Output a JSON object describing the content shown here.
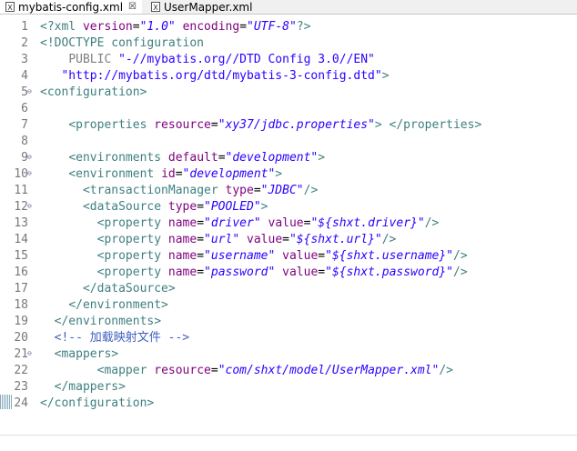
{
  "tabs": [
    {
      "label": "mybatis-config.xml",
      "close": "☒"
    },
    {
      "label": "UserMapper.xml"
    }
  ],
  "editor": {
    "lines": [
      {
        "n": "1",
        "fold": "",
        "html": "<span class=\"pi\">&lt;?xml</span> <span class=\"attr\">version</span><span class=\"text\">=</span><span class=\"val\">\"1.0\"</span> <span class=\"attr\">encoding</span><span class=\"text\">=</span><span class=\"val\">\"UTF-8\"</span><span class=\"pi\">?&gt;</span>"
      },
      {
        "n": "2",
        "fold": "",
        "html": "<span class=\"doctype\">&lt;!DOCTYPE configuration</span>"
      },
      {
        "n": "3",
        "fold": "",
        "html": "    <span class=\"pub\">PUBLIC</span> <span class=\"val\" style=\"font-style:normal\">\"-//mybatis.org//DTD Config 3.0//EN\"</span>"
      },
      {
        "n": "4",
        "fold": "",
        "html": "   <span class=\"val\" style=\"font-style:normal\">\"http://mybatis.org/dtd/mybatis-3-config.dtd\"</span><span class=\"doctype\">&gt;</span>"
      },
      {
        "n": "5",
        "fold": "⊖",
        "html": "<span class=\"tag\">&lt;configuration&gt;</span>"
      },
      {
        "n": "6",
        "fold": "",
        "html": ""
      },
      {
        "n": "7",
        "fold": "",
        "html": "    <span class=\"tag\">&lt;properties</span> <span class=\"attr\">resource</span><span class=\"text\">=</span><span class=\"val\">\"xy37/jdbc.properties\"</span><span class=\"tag\">&gt;</span> <span class=\"tag\">&lt;/properties&gt;</span>"
      },
      {
        "n": "8",
        "fold": "",
        "html": ""
      },
      {
        "n": "9",
        "fold": "⊖",
        "html": "    <span class=\"tag\">&lt;environments</span> <span class=\"attr\">default</span><span class=\"text\">=</span><span class=\"val\">\"development\"</span><span class=\"tag\">&gt;</span>"
      },
      {
        "n": "10",
        "fold": "⊖",
        "html": "    <span class=\"tag\">&lt;environment</span> <span class=\"attr\">id</span><span class=\"text\">=</span><span class=\"val\">\"development\"</span><span class=\"tag\">&gt;</span>"
      },
      {
        "n": "11",
        "fold": "",
        "html": "      <span class=\"tag\">&lt;transactionManager</span> <span class=\"attr\">type</span><span class=\"text\">=</span><span class=\"val\">\"JDBC\"</span><span class=\"tag\">/&gt;</span>"
      },
      {
        "n": "12",
        "fold": "⊖",
        "html": "      <span class=\"tag\">&lt;dataSource</span> <span class=\"attr\">type</span><span class=\"text\">=</span><span class=\"val\">\"POOLED\"</span><span class=\"tag\">&gt;</span>"
      },
      {
        "n": "13",
        "fold": "",
        "html": "        <span class=\"tag\">&lt;property</span> <span class=\"attr\">name</span><span class=\"text\">=</span><span class=\"val\">\"driver\"</span> <span class=\"attr\">value</span><span class=\"text\">=</span><span class=\"val\">\"${shxt.driver}\"</span><span class=\"tag\">/&gt;</span>"
      },
      {
        "n": "14",
        "fold": "",
        "html": "        <span class=\"tag\">&lt;property</span> <span class=\"attr\">name</span><span class=\"text\">=</span><span class=\"val\">\"url\"</span> <span class=\"attr\">value</span><span class=\"text\">=</span><span class=\"val\">\"${shxt.url}\"</span><span class=\"tag\">/&gt;</span>"
      },
      {
        "n": "15",
        "fold": "",
        "html": "        <span class=\"tag\">&lt;property</span> <span class=\"attr\">name</span><span class=\"text\">=</span><span class=\"val\">\"username\"</span> <span class=\"attr\">value</span><span class=\"text\">=</span><span class=\"val\">\"${shxt.username}\"</span><span class=\"tag\">/&gt;</span>"
      },
      {
        "n": "16",
        "fold": "",
        "html": "        <span class=\"tag\">&lt;property</span> <span class=\"attr\">name</span><span class=\"text\">=</span><span class=\"val\">\"password\"</span> <span class=\"attr\">value</span><span class=\"text\">=</span><span class=\"val\">\"${shxt.password}\"</span><span class=\"tag\">/&gt;</span>"
      },
      {
        "n": "17",
        "fold": "",
        "html": "      <span class=\"tag\">&lt;/dataSource&gt;</span>"
      },
      {
        "n": "18",
        "fold": "",
        "html": "    <span class=\"tag\">&lt;/environment&gt;</span>"
      },
      {
        "n": "19",
        "fold": "",
        "html": "  <span class=\"tag\">&lt;/environments&gt;</span>"
      },
      {
        "n": "20",
        "fold": "",
        "html": "  <span class=\"comment\">&lt;!-- 加载映射文件 --&gt;</span>"
      },
      {
        "n": "21",
        "fold": "⊖",
        "html": "  <span class=\"tag\">&lt;mappers&gt;</span>"
      },
      {
        "n": "22",
        "fold": "",
        "html": "        <span class=\"tag\">&lt;mapper</span> <span class=\"attr\">resource</span><span class=\"text\">=</span><span class=\"val\">\"com/shxt/model/UserMapper.xml\"</span><span class=\"tag\">/&gt;</span>"
      },
      {
        "n": "23",
        "fold": "",
        "html": "  <span class=\"tag\">&lt;/mappers&gt;</span>"
      },
      {
        "n": "24",
        "fold": "",
        "html": "<span class=\"tag\">&lt;/configuration&gt;</span>"
      }
    ]
  },
  "colors": {
    "tag": "#3f7f7f",
    "attribute": "#7f007f",
    "value": "#2a00ff",
    "comment": "#3f5fbf",
    "line_number": "#787878"
  }
}
